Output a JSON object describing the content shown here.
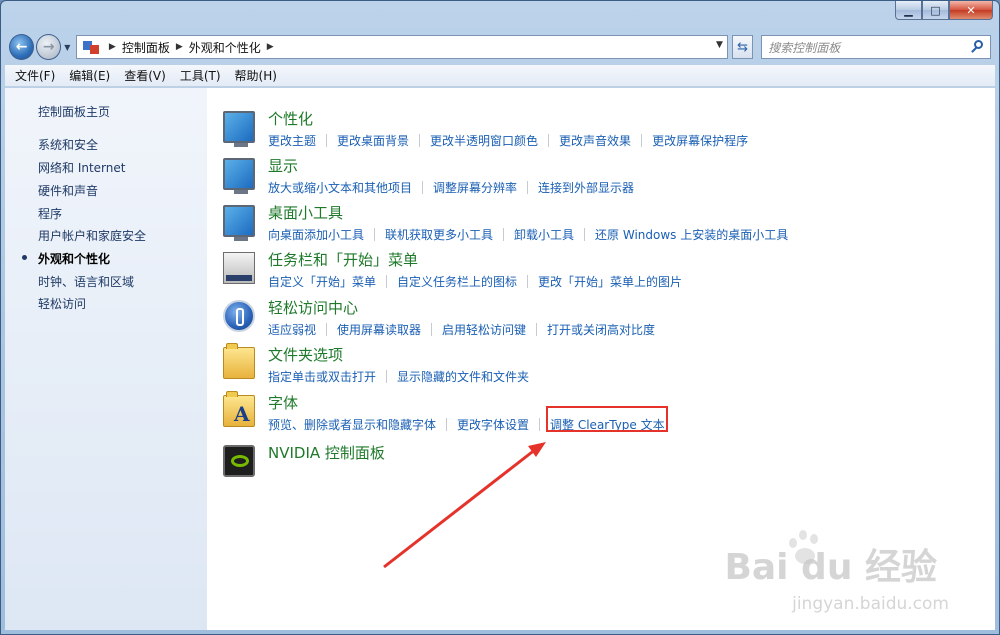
{
  "window": {
    "caption": {
      "minimize": "▁",
      "maximize": "□",
      "close": "✕"
    }
  },
  "address": {
    "crumbs": [
      "控制面板",
      "外观和个性化"
    ]
  },
  "search": {
    "placeholder": "搜索控制面板"
  },
  "menu": [
    "文件(F)",
    "编辑(E)",
    "查看(V)",
    "工具(T)",
    "帮助(H)"
  ],
  "sidebar": {
    "home": "控制面板主页",
    "items": [
      "系统和安全",
      "网络和 Internet",
      "硬件和声音",
      "程序",
      "用户帐户和家庭安全",
      "外观和个性化",
      "时钟、语言和区域",
      "轻松访问"
    ],
    "active_index": 5
  },
  "categories": [
    {
      "icon": "personalization-icon",
      "title": "个性化",
      "links": [
        "更改主题",
        "更改桌面背景",
        "更改半透明窗口颜色",
        "更改声音效果",
        "更改屏幕保护程序"
      ]
    },
    {
      "icon": "display-icon",
      "title": "显示",
      "links": [
        "放大或缩小文本和其他项目",
        "调整屏幕分辨率",
        "连接到外部显示器"
      ]
    },
    {
      "icon": "gadgets-icon",
      "title": "桌面小工具",
      "links": [
        "向桌面添加小工具",
        "联机获取更多小工具",
        "卸载小工具",
        "还原 Windows 上安装的桌面小工具"
      ]
    },
    {
      "icon": "taskbar-icon",
      "title": "任务栏和「开始」菜单",
      "links": [
        "自定义「开始」菜单",
        "自定义任务栏上的图标",
        "更改「开始」菜单上的图片"
      ]
    },
    {
      "icon": "ease-of-access-icon",
      "title": "轻松访问中心",
      "links": [
        "适应弱视",
        "使用屏幕读取器",
        "启用轻松访问键",
        "打开或关闭高对比度"
      ]
    },
    {
      "icon": "folder-options-icon",
      "title": "文件夹选项",
      "links": [
        "指定单击或双击打开",
        "显示隐藏的文件和文件夹"
      ]
    },
    {
      "icon": "fonts-icon",
      "title": "字体",
      "links": [
        "预览、删除或者显示和隐藏字体",
        "更改字体设置",
        "调整 ClearType 文本"
      ]
    },
    {
      "icon": "nvidia-icon",
      "title": "NVIDIA 控制面板",
      "links": []
    }
  ],
  "colors": {
    "title_green": "#1e7a2a",
    "link_blue": "#1a5fb4",
    "highlight_red": "#e5322b"
  },
  "watermark": {
    "logo": "Bai du 经验",
    "url": "jingyan.baidu.com"
  }
}
